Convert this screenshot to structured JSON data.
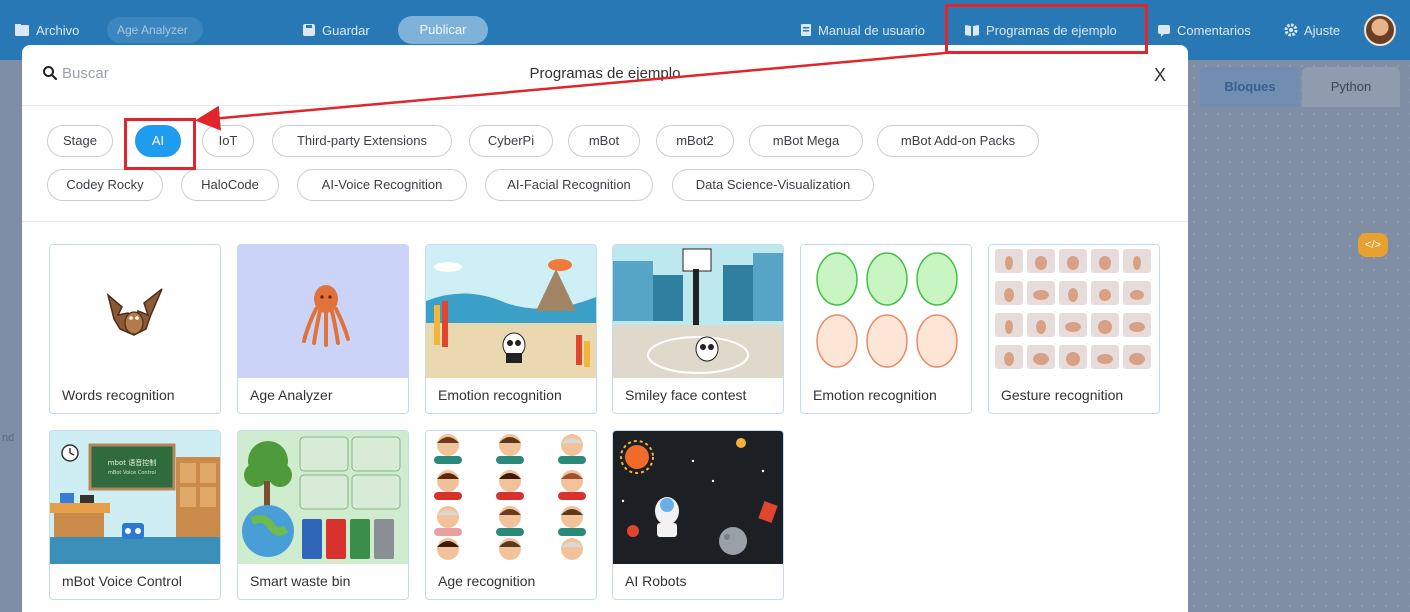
{
  "topbar": {
    "file_label": "Archivo",
    "project_name": "Age Analyzer",
    "save_label": "Guardar",
    "publish_label": "Publicar",
    "manual_label": "Manual de usuario",
    "examples_label": "Programas de ejemplo",
    "comments_label": "Comentarios",
    "settings_label": "Ajuste"
  },
  "background": {
    "blocks_tab": "Bloques",
    "python_tab": "Python",
    "code_badge": "</>"
  },
  "modal": {
    "search_placeholder": "Buscar",
    "title": "Programas de ejemplo",
    "close": "X"
  },
  "categories": [
    "Stage",
    "AI",
    "IoT",
    "Third-party Extensions",
    "CyberPi",
    "mBot",
    "mBot2",
    "mBot Mega",
    "mBot Add-on Packs",
    "Codey Rocky",
    "HaloCode",
    "AI-Voice Recognition",
    "AI-Facial Recognition",
    "Data Science-Visualization"
  ],
  "active_category": "AI",
  "programs": [
    "Words recognition",
    "Age Analyzer",
    "Emotion recognition",
    "Smiley face contest",
    "Emotion recognition",
    "Gesture recognition",
    "mBot Voice Control",
    "Smart waste bin",
    "Age recognition",
    "AI Robots"
  ],
  "thumb_text": {
    "voice_board_line1": "mbot 语音控制",
    "voice_board_line2": "mBot Voice Control"
  },
  "colors": {
    "topbar": "#2778b4",
    "accent": "#1f9bf0",
    "highlight": "#e0262b"
  }
}
